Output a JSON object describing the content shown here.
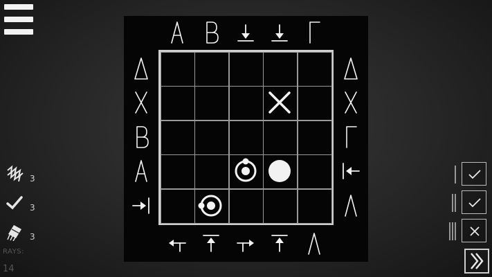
{
  "board": {
    "top": [
      {
        "kind": "letter",
        "value": "A"
      },
      {
        "kind": "letter",
        "value": "B"
      },
      {
        "kind": "arrow",
        "icon": "arrow-down-icon"
      },
      {
        "kind": "arrow",
        "icon": "arrow-down-icon"
      },
      {
        "kind": "letter",
        "value": "Γ"
      }
    ],
    "left": [
      {
        "kind": "letter",
        "value": "Δ"
      },
      {
        "kind": "letter",
        "value": "X"
      },
      {
        "kind": "letter",
        "value": "B"
      },
      {
        "kind": "letter",
        "value": "A"
      },
      {
        "kind": "arrow",
        "icon": "arrow-right-icon"
      }
    ],
    "right": [
      {
        "kind": "letter",
        "value": "Δ"
      },
      {
        "kind": "letter",
        "value": "X"
      },
      {
        "kind": "letter",
        "value": "Γ"
      },
      {
        "kind": "arrow",
        "icon": "arrow-left-icon"
      },
      {
        "kind": "letter",
        "value": "Λ"
      }
    ],
    "bottom": [
      {
        "kind": "arrow",
        "icon": "arrow-up-left-turn-icon"
      },
      {
        "kind": "arrow",
        "icon": "arrow-up-icon"
      },
      {
        "kind": "arrow",
        "icon": "arrow-up-right-turn-icon"
      },
      {
        "kind": "arrow",
        "icon": "arrow-up-icon"
      },
      {
        "kind": "letter",
        "value": "Λ"
      }
    ],
    "pieces": [
      {
        "row": 1,
        "col": 3,
        "icon": "cross-marker-icon"
      },
      {
        "row": 3,
        "col": 2,
        "icon": "orbiting-atom-icon"
      },
      {
        "row": 3,
        "col": 3,
        "icon": "solid-atom-icon"
      },
      {
        "row": 4,
        "col": 1,
        "icon": "orbiting-atom-icon"
      }
    ]
  },
  "tools": [
    {
      "icon": "zigzag-ray-icon",
      "count": "3"
    },
    {
      "icon": "checkmark-icon",
      "count": "3"
    },
    {
      "icon": "eraser-icon",
      "count": "3"
    }
  ],
  "rays": {
    "label": "RAYS:",
    "value": "14"
  },
  "results": [
    {
      "numeral": "I",
      "status": "correct",
      "icon": "check-icon"
    },
    {
      "numeral": "II",
      "status": "correct",
      "icon": "check-icon"
    },
    {
      "numeral": "III",
      "status": "wrong",
      "icon": "cross-icon"
    }
  ],
  "colors": {
    "board": "#050505",
    "grid": "#cfcfcf",
    "glyph": "#f2f2f2"
  }
}
